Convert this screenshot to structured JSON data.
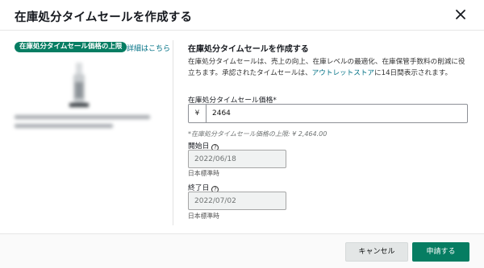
{
  "dialog": {
    "title": "在庫処分タイムセールを作成する"
  },
  "left_panel": {
    "badge": "在庫処分タイムセール価格の上限",
    "details_link": "詳細はこちら"
  },
  "form": {
    "section_title": "在庫処分タイムセールを作成する",
    "description_pre": "在庫処分タイムセールは、売上の向上、在庫レベルの最適化、在庫保管手数料の削減に役立ちます。承認されたタイムセールは、",
    "description_link": "アウトレットストア",
    "description_post": "に14日間表示されます。",
    "price_label": "在庫処分タイムセール価格*",
    "currency": "¥",
    "price_value": "2464",
    "price_hint": "*在庫処分タイムセール価格の上限: ¥ 2,464.00",
    "start_label": "開始日",
    "start_date": "2022/06/18",
    "start_tz": "日本標準時",
    "end_label": "終了日",
    "end_date": "2022/07/02",
    "end_tz": "日本標準時",
    "help_glyph": "?"
  },
  "footer": {
    "cancel_label": "キャンセル",
    "apply_label": "申請する"
  },
  "colors": {
    "accent": "#067d62",
    "link": "#007185"
  },
  "icons": {
    "close": "close-icon",
    "help": "question-circle-icon"
  }
}
